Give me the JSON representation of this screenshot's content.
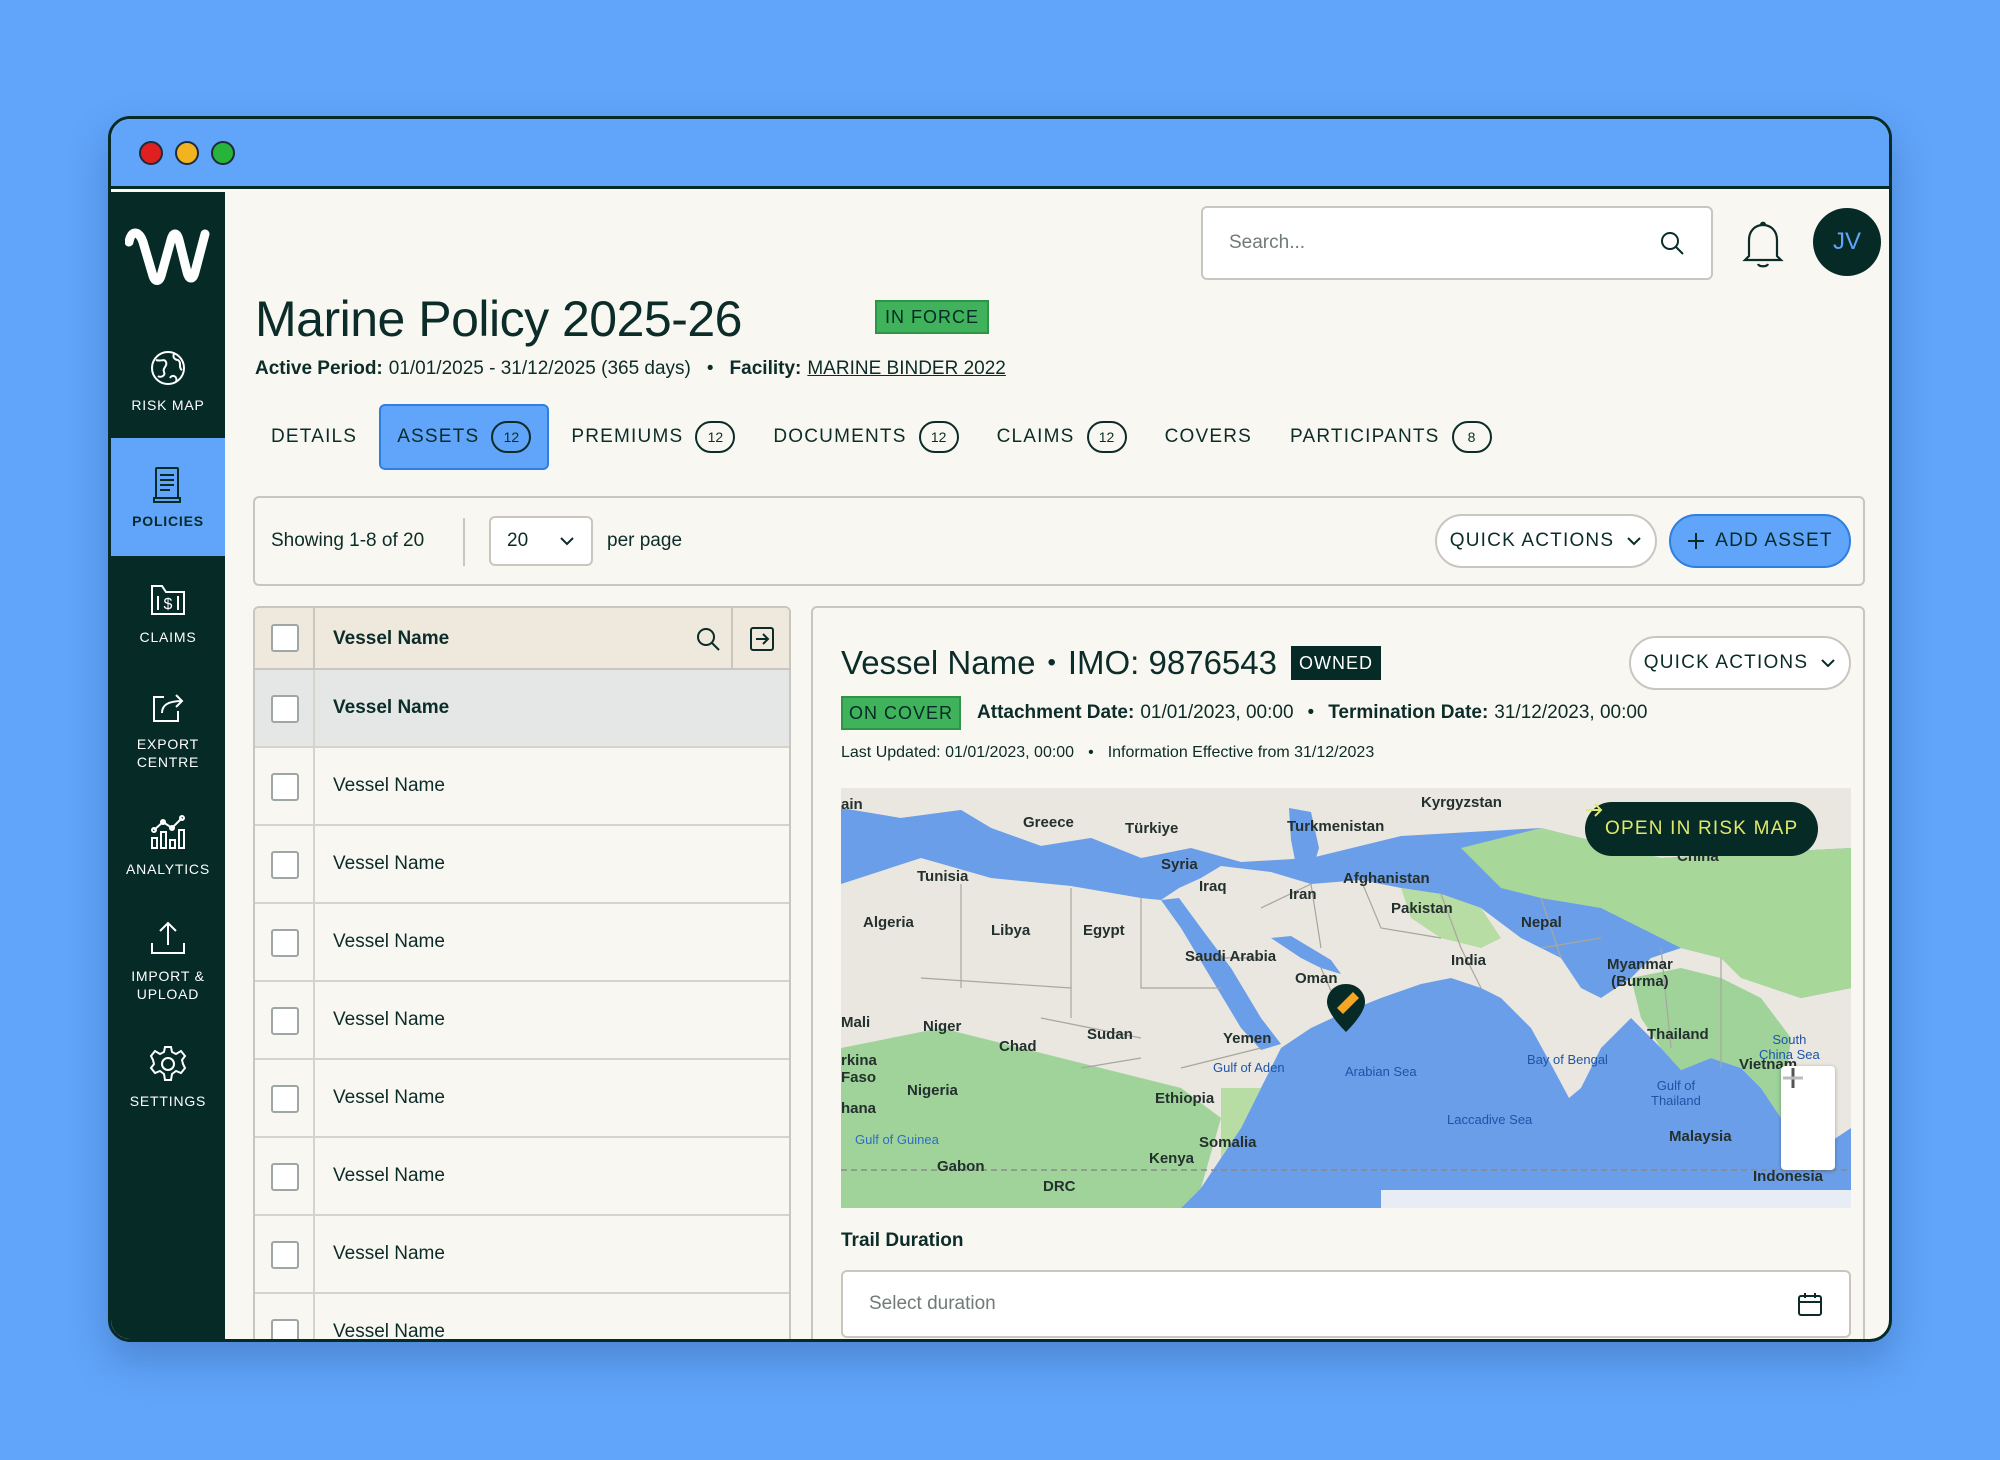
{
  "sidebar": {
    "items": [
      {
        "label": "RISK MAP",
        "icon": "globe-icon"
      },
      {
        "label": "POLICIES",
        "icon": "document-icon"
      },
      {
        "label": "CLAIMS",
        "icon": "dollar-folder-icon"
      },
      {
        "label": "EXPORT\nCENTRE",
        "icon": "export-icon"
      },
      {
        "label": "ANALYTICS",
        "icon": "analytics-icon"
      },
      {
        "label": "IMPORT &\nUPLOAD",
        "icon": "upload-icon"
      },
      {
        "label": "SETTINGS",
        "icon": "gear-icon"
      }
    ]
  },
  "header": {
    "search_placeholder": "Search...",
    "avatar_initials": "JV"
  },
  "policy": {
    "title": "Marine Policy 2025-26",
    "status": "IN FORCE",
    "active_period_label": "Active Period:",
    "active_period_value": "01/01/2025 - 31/12/2025 (365 days)",
    "facility_label": "Facility:",
    "facility_value": "MARINE BINDER 2022"
  },
  "tabs": [
    {
      "label": "DETAILS"
    },
    {
      "label": "ASSETS",
      "count": "12"
    },
    {
      "label": "PREMIUMS",
      "count": "12"
    },
    {
      "label": "DOCUMENTS",
      "count": "12"
    },
    {
      "label": "CLAIMS",
      "count": "12"
    },
    {
      "label": "COVERS"
    },
    {
      "label": "PARTICIPANTS",
      "count": "8"
    }
  ],
  "toolbar": {
    "showing": "Showing 1-8 of 20",
    "per_page_value": "20",
    "per_page_label": "per page",
    "quick_actions": "QUICK ACTIONS",
    "add_asset": "ADD ASSET"
  },
  "list": {
    "column_header": "Vessel Name",
    "rows": [
      "Vessel Name",
      "Vessel Name",
      "Vessel Name",
      "Vessel Name",
      "Vessel Name",
      "Vessel Name",
      "Vessel Name",
      "Vessel Name",
      "Vessel Name"
    ]
  },
  "detail": {
    "name": "Vessel Name",
    "imo": "IMO: 9876543",
    "ownership": "OWNED",
    "quick_actions": "QUICK ACTIONS",
    "cover_status": "ON COVER",
    "attachment_label": "Attachment Date:",
    "attachment_value": "01/01/2023, 00:00",
    "termination_label": "Termination Date:",
    "termination_value": "31/12/2023, 00:00",
    "last_updated": "Last Updated: 01/01/2023, 00:00",
    "effective": "Information Effective from 31/12/2023",
    "open_risk_map": "OPEN IN RISK MAP",
    "trail_label": "Trail Duration",
    "duration_placeholder": "Select duration"
  },
  "map": {
    "countries": [
      "ain",
      "Greece",
      "Türkiye",
      "Turkmenistan",
      "Kyrgyzstan",
      "China",
      "Tunisia",
      "Syria",
      "Iraq",
      "Iran",
      "Afghanistan",
      "Pakistan",
      "Nepal",
      "Algeria",
      "Libya",
      "Egypt",
      "Saudi Arabia",
      "India",
      "Myanmar\n(Burma)",
      "Oman",
      "Mali",
      "Niger",
      "Chad",
      "Sudan",
      "Yemen",
      "Thailand",
      "rkina\nFaso",
      "Nigeria",
      "Ethiopia",
      "Vietnam",
      "hana",
      "Somalia",
      "Malaysia",
      "Gabon",
      "Kenya",
      "DRC",
      "Indonesia"
    ],
    "seas": [
      "Gulf of Aden",
      "Arabian Sea",
      "Bay of Bengal",
      "South\nChina Sea",
      "Gulf of\nThailand",
      "Laccadive Sea",
      "Gulf of Guinea"
    ]
  },
  "colors": {
    "sidebar": "#062a26",
    "accent": "#60a5fa",
    "status_green": "#3fb25b",
    "map_water": "#6b9ee8",
    "map_land": "#e9e7df",
    "map_green": "#9fd39a"
  }
}
